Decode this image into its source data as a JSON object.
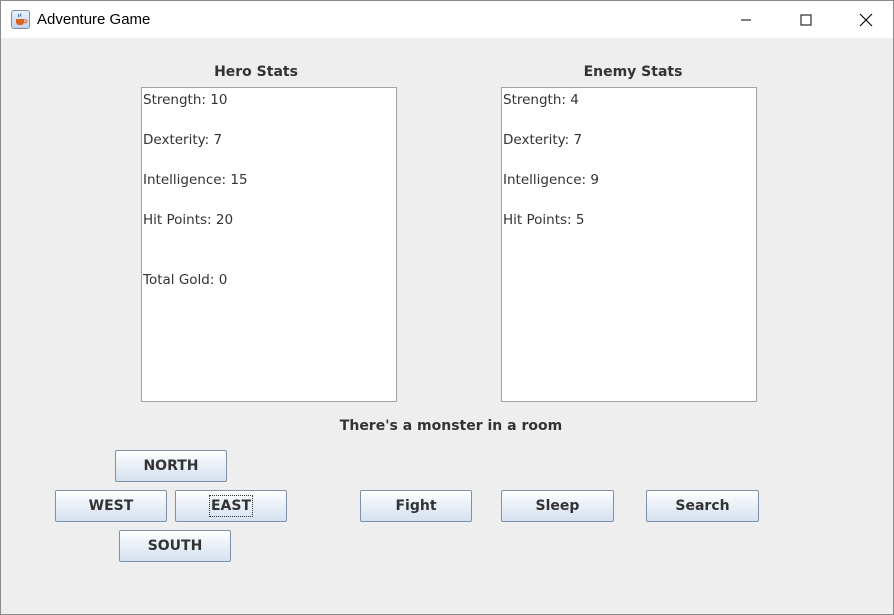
{
  "window": {
    "title": "Adventure Game",
    "icon": "java-cup-icon"
  },
  "hero": {
    "label": "Hero Stats",
    "lines": [
      "Strength: 10",
      "Dexterity: 7",
      "Intelligence: 15",
      "Hit Points: 20",
      "Total Gold: 0"
    ]
  },
  "enemy": {
    "label": "Enemy Stats",
    "lines": [
      "Strength: 4",
      "Dexterity: 7",
      "Intelligence: 9",
      "Hit Points: 5"
    ]
  },
  "message": "There's a monster in a room",
  "buttons": {
    "north": "NORTH",
    "west": "WEST",
    "east": "EAST",
    "south": "SOUTH",
    "fight": "Fight",
    "sleep": "Sleep",
    "search": "Search"
  }
}
